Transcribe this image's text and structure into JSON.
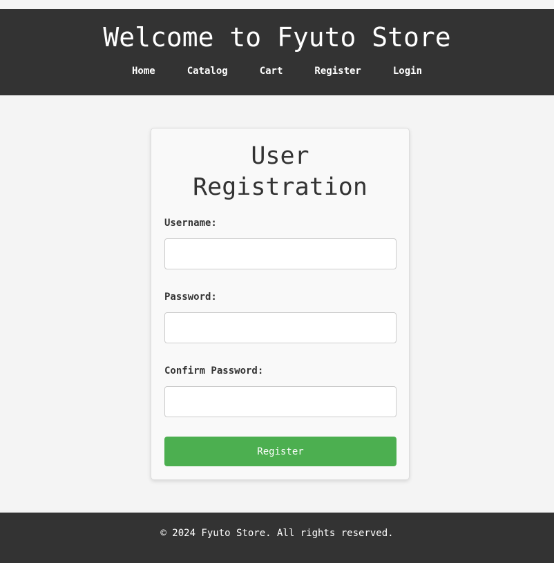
{
  "header": {
    "title": "Welcome to Fyuto Store",
    "nav": [
      {
        "label": "Home"
      },
      {
        "label": "Catalog"
      },
      {
        "label": "Cart"
      },
      {
        "label": "Register"
      },
      {
        "label": "Login"
      }
    ]
  },
  "form": {
    "title": "User Registration",
    "fields": [
      {
        "label": "Username:",
        "value": "",
        "placeholder": ""
      },
      {
        "label": "Password:",
        "value": "",
        "placeholder": ""
      },
      {
        "label": "Confirm Password:",
        "value": "",
        "placeholder": ""
      }
    ],
    "submit_label": "Register",
    "submit_color": "#4caf50"
  },
  "footer": {
    "text": "© 2024 Fyuto Store. All rights reserved."
  },
  "colors": {
    "header_bg": "#333333",
    "page_bg": "#f4f4f4",
    "card_bg": "#f9f9f9"
  }
}
